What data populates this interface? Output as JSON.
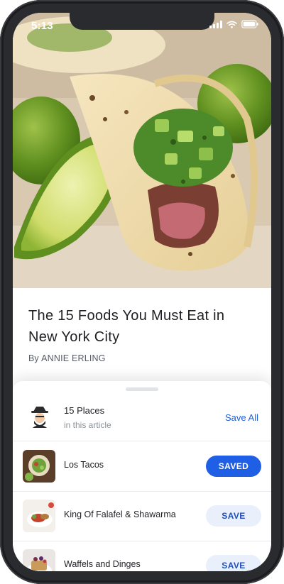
{
  "status_bar": {
    "time": "5:13"
  },
  "article": {
    "title": "The 15 Foods You Must Eat in New York City",
    "byline_prefix": "By",
    "author": "ANNIE ERLING"
  },
  "sheet": {
    "places_count_label": "15 Places",
    "places_sub_label": "in this article",
    "save_all_label": "Save All",
    "places": [
      {
        "name": "Los Tacos",
        "button_label": "SAVED",
        "saved": true
      },
      {
        "name": "King Of Falafel & Shawarma",
        "button_label": "SAVE",
        "saved": false
      },
      {
        "name": "Waffels and Dinges",
        "button_label": "SAVE",
        "saved": false
      }
    ]
  },
  "colors": {
    "accent": "#1f5fe5",
    "save_bg": "#e9f0fb",
    "text_dark": "#1f1f24",
    "text_muted": "#8b9098",
    "device": "#2a2b2f"
  },
  "icons": [
    "signal-icon",
    "wifi-icon",
    "battery-icon",
    "chef-hat-icon"
  ]
}
